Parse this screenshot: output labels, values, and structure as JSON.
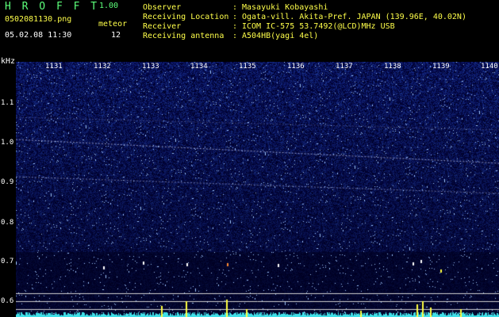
{
  "header": {
    "app_name": "H R O F F T",
    "version": "1.00",
    "filename": "0502081130.png",
    "meteor_label": "meteor",
    "datetime": "05.02.08 11:30",
    "meteor_count": "12"
  },
  "info": [
    {
      "label": "Observer",
      "value": "Masayuki Kobayashi"
    },
    {
      "label": "Receiving Location",
      "value": "Ogata-vill. Akita-Pref. JAPAN (139.96E, 40.02N)"
    },
    {
      "label": "Receiver",
      "value": "ICOM IC-575 53.7492(@LCD)MHz USB"
    },
    {
      "label": "Receiving antenna",
      "value": "A504HB(yagi 4el)"
    }
  ],
  "spectrogram": {
    "y_unit": "kHz",
    "y_ticks": [
      "1.1",
      "1.0",
      "0.9",
      "0.8",
      "0.7",
      "0.6"
    ],
    "x_ticks": [
      "1131",
      "1132",
      "1133",
      "1134",
      "1135",
      "1136",
      "1137",
      "1138",
      "1139",
      "1140"
    ],
    "colors": {
      "background": "#08082a",
      "noise_base": "#1a1aa0",
      "noise_bright": "#6a7aff",
      "trace": "#c8d0ff",
      "grid": "#d0d0d0",
      "meteor_yellow": "#ffff40",
      "meteor_orange": "#ff8a30",
      "meteor_white": "#ffffff",
      "bottom_noise": "#40e0e8"
    }
  }
}
